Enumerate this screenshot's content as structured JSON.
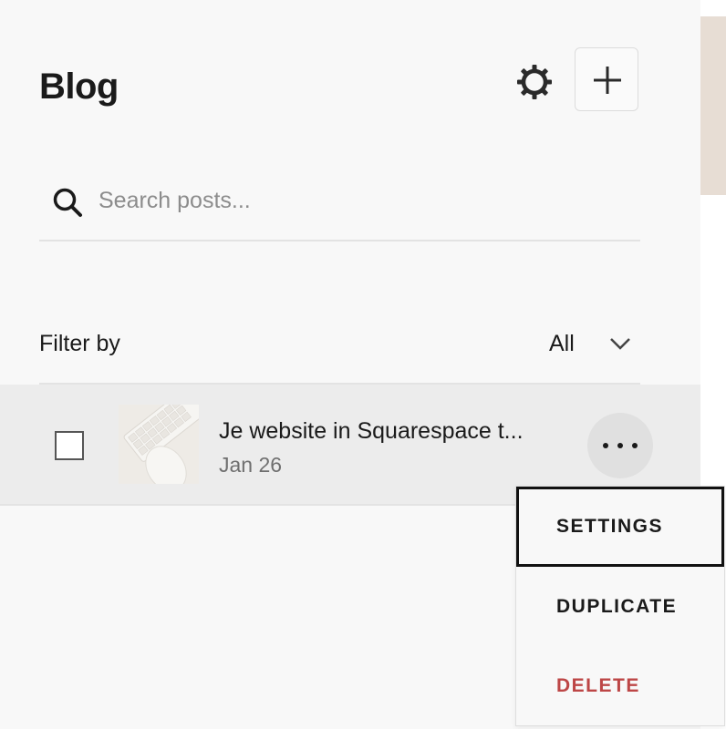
{
  "header": {
    "title": "Blog",
    "settings_icon": "gear-icon",
    "add_icon": "plus-icon"
  },
  "search": {
    "placeholder": "Search posts...",
    "value": "",
    "icon": "search-icon"
  },
  "filter": {
    "label": "Filter by",
    "selected": "All",
    "icon": "chevron-down-icon"
  },
  "posts": [
    {
      "title": "Je website in Squarespace t...",
      "date": "Jan 26",
      "thumbnail": "keyboard-and-mouse-photo",
      "checked": false
    }
  ],
  "context_menu": {
    "items": [
      {
        "label": "SETTINGS",
        "focused": true
      },
      {
        "label": "DUPLICATE",
        "focused": false
      },
      {
        "label": "DELETE",
        "danger": true,
        "color": "#bd4646"
      }
    ]
  },
  "colors": {
    "background": "#f8f8f8",
    "row_selected": "#ececec",
    "danger": "#bd4646",
    "accent_strip": "#e7ddd4"
  }
}
